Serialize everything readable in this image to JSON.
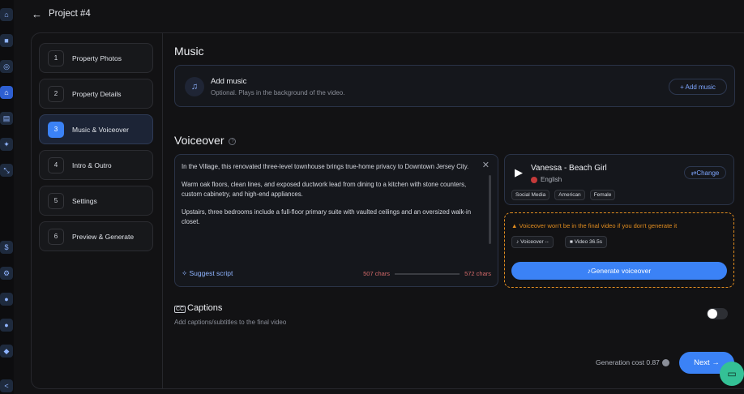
{
  "header": {
    "title": "Project #4"
  },
  "rail": {
    "icons": [
      "bank-icon",
      "video-icon",
      "compass-icon",
      "home-icon",
      "film-icon",
      "magic-wand-icon",
      "collapse-icon",
      "dollar-icon",
      "gear-icon",
      "users-icon",
      "team-icon",
      "chat-icon",
      "share-icon"
    ]
  },
  "steps": [
    {
      "num": "1",
      "label": "Property Photos"
    },
    {
      "num": "2",
      "label": "Property Details"
    },
    {
      "num": "3",
      "label": "Music & Voiceover"
    },
    {
      "num": "4",
      "label": "Intro & Outro"
    },
    {
      "num": "5",
      "label": "Settings"
    },
    {
      "num": "6",
      "label": "Preview & Generate"
    }
  ],
  "music": {
    "heading": "Music",
    "title": "Add music",
    "subtitle": "Optional. Plays in the background of the video.",
    "button": "+ Add music"
  },
  "voiceover": {
    "heading": "Voiceover",
    "script": [
      "In the Village, this renovated three-level townhouse brings true-home privacy to Downtown Jersey City.",
      "Warm oak floors, clean lines, and exposed ductwork lead from dining to a kitchen with stone counters, custom cabinetry, and high-end appliances.",
      "Upstairs, three bedrooms include a full-floor primary suite with vaulted ceilings and an oversized walk-in closet."
    ],
    "suggest": "Suggest script",
    "chars_current": "507 chars",
    "chars_max": "572 chars",
    "voice_name": "Vanessa - Beach Girl",
    "voice_lang": "English",
    "change": "Change",
    "tags": [
      "Social Media",
      "American",
      "Female"
    ],
    "warning": "Voiceover won't be in the final video if you don't generate it",
    "chip_voice": "Voiceover --",
    "chip_video": "Video 36.5s",
    "generate": "Generate voiceover"
  },
  "captions": {
    "icon_text": "CC",
    "title": "Captions",
    "subtitle": "Add captions/subtitles to the final video",
    "enabled": false
  },
  "footer": {
    "cost": "Generation cost 0.87",
    "next": "Next"
  },
  "colors": {
    "accent": "#3b82f6",
    "warning": "#e28d1f",
    "support": "#34c196"
  }
}
